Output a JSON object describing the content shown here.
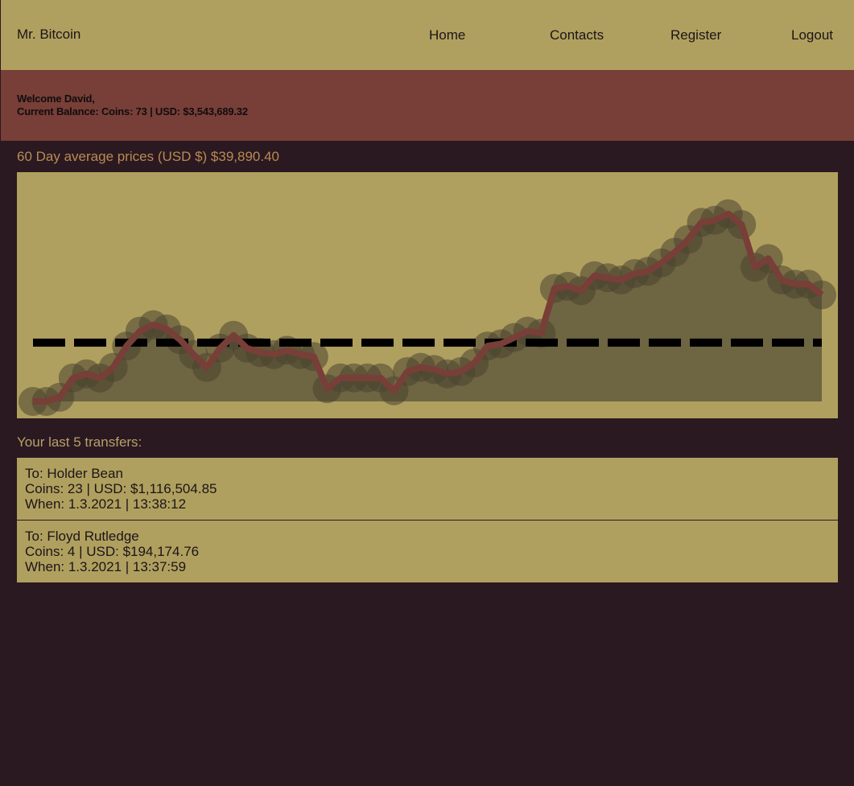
{
  "header": {
    "brand": "Mr. Bitcoin",
    "nav": {
      "home": "Home",
      "contacts": "Contacts",
      "register": "Register",
      "logout": "Logout"
    }
  },
  "welcome": {
    "greeting": "Welcome David,",
    "balance": "Current Balance: Coins: 73 | USD: $3,543,689.32"
  },
  "price_chart": {
    "title": "60 Day average prices (USD $) $39,890.40"
  },
  "chart_data": {
    "type": "area",
    "title": "60 Day average prices (USD $) $39,890.40",
    "xlabel": "",
    "ylabel": "",
    "values": [
      0.0,
      0.0,
      0.02,
      0.11,
      0.13,
      0.11,
      0.16,
      0.26,
      0.33,
      0.36,
      0.34,
      0.29,
      0.22,
      0.16,
      0.25,
      0.31,
      0.25,
      0.23,
      0.22,
      0.24,
      0.22,
      0.21,
      0.06,
      0.11,
      0.11,
      0.11,
      0.11,
      0.05,
      0.14,
      0.16,
      0.15,
      0.13,
      0.14,
      0.18,
      0.26,
      0.27,
      0.3,
      0.33,
      0.32,
      0.53,
      0.54,
      0.52,
      0.59,
      0.58,
      0.57,
      0.6,
      0.61,
      0.65,
      0.7,
      0.76,
      0.84,
      0.85,
      0.88,
      0.83,
      0.63,
      0.67,
      0.57,
      0.55,
      0.55,
      0.5
    ],
    "average_line": 0.276,
    "y_range": [
      0,
      1
    ],
    "grid": false,
    "legend": "none",
    "colors": {
      "line": "#773f37",
      "fill": "#6e6542",
      "markers": "#4a4330",
      "average": "#000000",
      "background": "#b0a05f"
    }
  },
  "transfers": {
    "title": "Your last 5 transfers:",
    "items": [
      {
        "to": "To: Holder Bean",
        "coins": "Coins: 23 | USD: $1,116,504.85",
        "when": "When: 1.3.2021 | 13:38:12"
      },
      {
        "to": "To: Floyd Rutledge",
        "coins": "Coins: 4 | USD: $194,174.76",
        "when": "When: 1.3.2021 | 13:37:59"
      }
    ]
  }
}
